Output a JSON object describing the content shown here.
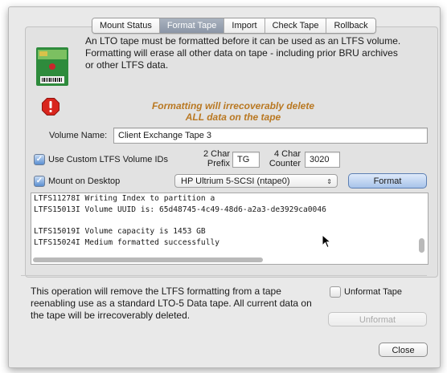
{
  "tabs": [
    "Mount Status",
    "Format Tape",
    "Import",
    "Check Tape",
    "Rollback"
  ],
  "active_tab": "Format Tape",
  "intro_text": "An LTO tape must be formatted before it can be used as an LTFS volume.  Formatting will erase all other data on tape - including prior BRU archives or other LTFS data.",
  "warning": {
    "line1": "Formatting will irrecoverably delete",
    "line2": "ALL data on the tape"
  },
  "volume_name": {
    "label": "Volume Name:",
    "value": "Client Exchange Tape 3"
  },
  "custom_ids": {
    "checkbox_label": "Use Custom LTFS Volume IDs",
    "checked": true,
    "prefix_label_1": "2 Char",
    "prefix_label_2": "Prefix",
    "prefix_value": "TG",
    "counter_label_1": "4 Char",
    "counter_label_2": "Counter",
    "counter_value": "3020"
  },
  "mount": {
    "checkbox_label": "Mount on Desktop",
    "checked": true
  },
  "drive_select": {
    "selected": "HP Ultrium 5-SCSI (ntape0)"
  },
  "format_button": "Format",
  "log_lines": [
    "LTFS11278I Writing Index to partition a",
    "LTFS15013I Volume UUID is: 65d48745-4c49-48d6-a2a3-de3929ca0046",
    "",
    "LTFS15019I Volume capacity is 1453 GB",
    "LTFS15024I Medium formatted successfully"
  ],
  "unformat": {
    "text": "This operation will remove the LTFS formatting from a tape reenabling use as a standard LTO-5 Data tape. All current data on the tape will be irrecoverably deleted.",
    "checkbox_label": "Unformat Tape",
    "checked": false,
    "button": "Unformat"
  },
  "close_button": "Close",
  "colors": {
    "warning": "#b97822",
    "active_tab": "#8b96a6",
    "stop_red": "#d9251d"
  },
  "icons": {
    "tape": "tape-cartridge-icon",
    "stop": "stop-icon",
    "cursor": "mouse-pointer-icon"
  }
}
